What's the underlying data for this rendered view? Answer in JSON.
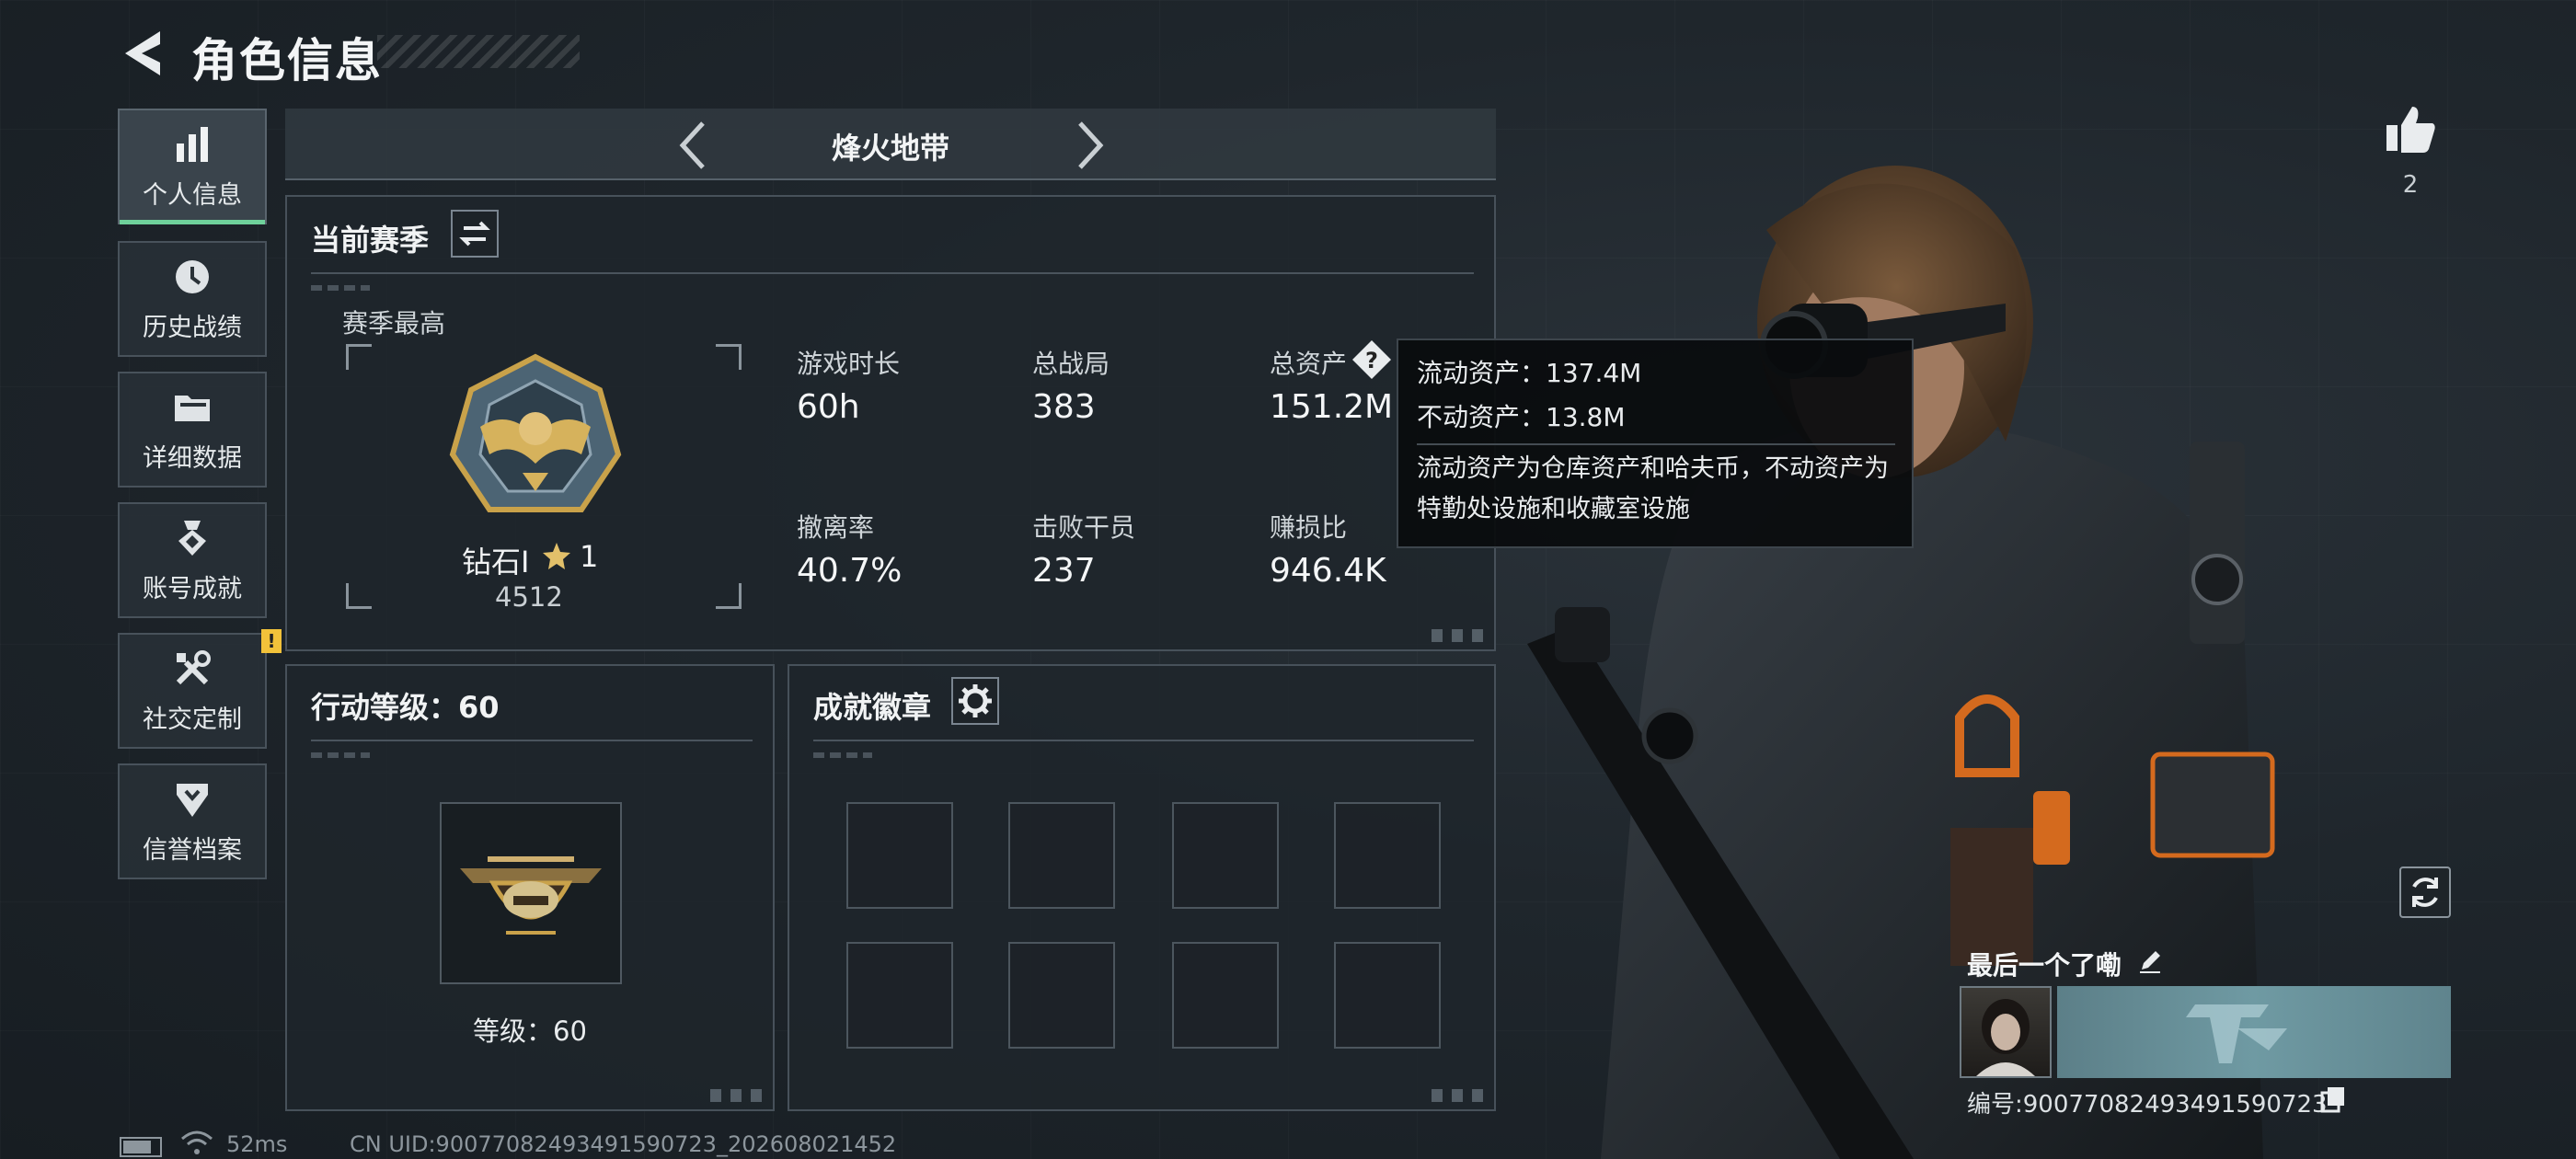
{
  "header": {
    "title": "角色信息",
    "back_icon": "back-arrow-icon"
  },
  "sidebar": {
    "items": [
      {
        "label": "个人信息",
        "icon": "bar-chart-icon",
        "active": true
      },
      {
        "label": "历史战绩",
        "icon": "clock-history-icon",
        "active": false
      },
      {
        "label": "详细数据",
        "icon": "folder-icon",
        "active": false
      },
      {
        "label": "账号成就",
        "icon": "medal-icon",
        "active": false
      },
      {
        "label": "社交定制",
        "icon": "tools-icon",
        "active": false,
        "alert": "!"
      },
      {
        "label": "信誉档案",
        "icon": "shield-icon",
        "active": false
      }
    ]
  },
  "mode": {
    "title": "烽火地带"
  },
  "season": {
    "title": "当前赛季",
    "best_label": "赛季最高",
    "rank_name": "钻石Ⅰ",
    "rank_stars": "1",
    "rank_points": "4512",
    "stats": [
      {
        "label": "游戏时长",
        "value": "60h"
      },
      {
        "label": "总战局",
        "value": "383"
      },
      {
        "label": "总资产",
        "value": "151.2M"
      },
      {
        "label": "撤离率",
        "value": "40.7%"
      },
      {
        "label": "击败干员",
        "value": "237"
      },
      {
        "label": "赚损比",
        "value": "946.4K"
      }
    ]
  },
  "tooltip": {
    "liquid": "流动资产：137.4M",
    "fixed": "不动资产：13.8M",
    "description": "流动资产为仓库资产和哈夫币，不动资产为特勤处设施和收藏室设施"
  },
  "action_level": {
    "title": "行动等级：60",
    "level_text": "等级：60"
  },
  "badges": {
    "title": "成就徽章",
    "slot_count": 8
  },
  "likes": {
    "count": "2"
  },
  "player": {
    "name": "最后一个了嘞",
    "id_text": "编号:90077082493491590723"
  },
  "status": {
    "ping": "52ms",
    "uid": "CN UID:90077082493491590723_202608021452"
  },
  "colors": {
    "accent": "#6fd19b",
    "alert": "#f2c23a",
    "gold": "#c9a24a"
  }
}
